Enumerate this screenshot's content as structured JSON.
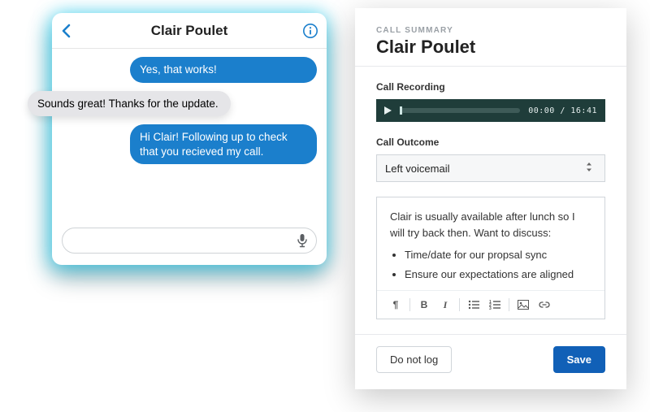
{
  "chat": {
    "title": "Clair Poulet",
    "messages": [
      {
        "direction": "out",
        "text": "Yes, that works!"
      },
      {
        "direction": "in",
        "text": "Sounds great! Thanks for the update.",
        "overlap": true
      },
      {
        "direction": "out",
        "text": "Hi Clair! Following up to check that you recieved my call."
      }
    ],
    "input_placeholder": ""
  },
  "summary": {
    "eyebrow": "CALL SUMMARY",
    "title": "Clair Poulet",
    "recording": {
      "label": "Call Recording",
      "elapsed": "00:00",
      "total": "16:41",
      "time_display": "00:00 / 16:41"
    },
    "outcome": {
      "label": "Call Outcome",
      "selected": "Left voicemail"
    },
    "notes": {
      "intro": "Clair is usually available after lunch so I will try back then. Want to discuss:",
      "bullets": [
        "Time/date for our propsal sync",
        "Ensure our expectations are aligned"
      ]
    },
    "buttons": {
      "dismiss": "Do not log",
      "save": "Save"
    }
  },
  "colors": {
    "accent_blue": "#1b7fcc",
    "primary_button": "#1160b7",
    "player_bg": "#1f3d3a"
  }
}
